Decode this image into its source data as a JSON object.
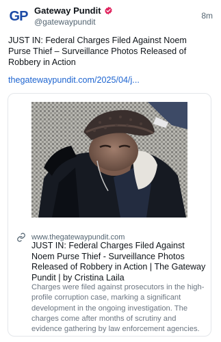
{
  "post": {
    "author": {
      "avatar_letters": [
        "G",
        "P"
      ],
      "display_name": "Gateway Pundit",
      "handle": "@gatewaypundit",
      "verified_icon": "verified-badge-icon"
    },
    "time": "8m",
    "text": "JUST IN: Federal Charges Filed Against Noem Purse Thief – Surveillance Photos Released of Robbery in Action",
    "link": "thegatewaypundit.com/2025/04/j..."
  },
  "card": {
    "domain": "www.thegatewaypundit.com",
    "link_icon": "link-icon",
    "title": "JUST IN: Federal Charges Filed Against Noem Purse Thief - Surveillance Photos Released of Robbery in Action | The Gateway Pundit | by Cristina Laila",
    "description": "Charges were filed against prosecutors in the high-profile corruption case, marking a significant development in the ongoing investigation. The charges come after months of scrutiny and evidence gathering by law enforcement agencies."
  },
  "colors": {
    "link": "#1d64d0",
    "verified": "#e0245e",
    "muted": "#536471",
    "brand": "#1b4aa6"
  }
}
